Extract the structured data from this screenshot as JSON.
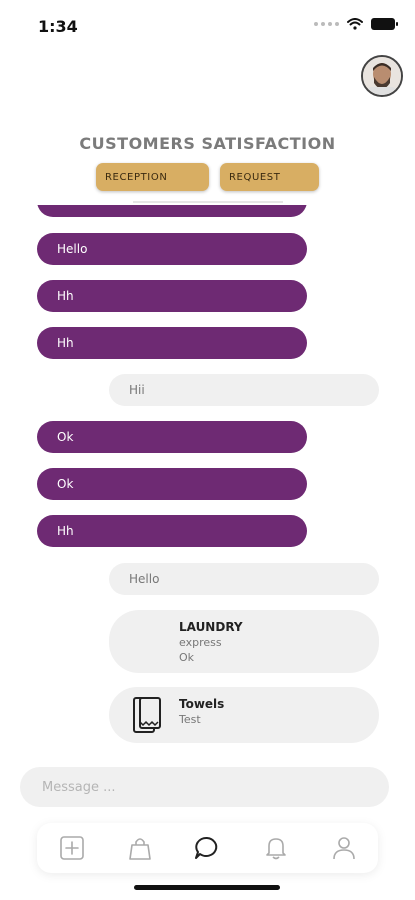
{
  "status_bar": {
    "time": "1:34"
  },
  "header": {
    "title": "CUSTOMERS SATISFACTION"
  },
  "tabs": [
    {
      "label": "RECEPTION"
    },
    {
      "label": "REQUEST"
    }
  ],
  "messages": {
    "m1": "Hello",
    "m2": "Hh",
    "m3": "Hh",
    "m4": "Hii",
    "m5": "Ok",
    "m6": "Ok",
    "m7": "Hh",
    "m8": "Hello"
  },
  "cards": {
    "laundry": {
      "title": "LAUNDRY",
      "line1": "express",
      "line2": "Ok"
    },
    "towels": {
      "title": "Towels",
      "line1": "Test"
    }
  },
  "composer": {
    "placeholder": "Message ..."
  },
  "colors": {
    "accent_purple": "#6e2a73",
    "tab_gold": "#d8ae63",
    "bubble_grey": "#f0f0f0"
  },
  "icons": {
    "nav": [
      "plus-square-icon",
      "bag-icon",
      "chat-bubble-icon",
      "bell-icon",
      "user-icon"
    ],
    "card": "towel-icon"
  }
}
